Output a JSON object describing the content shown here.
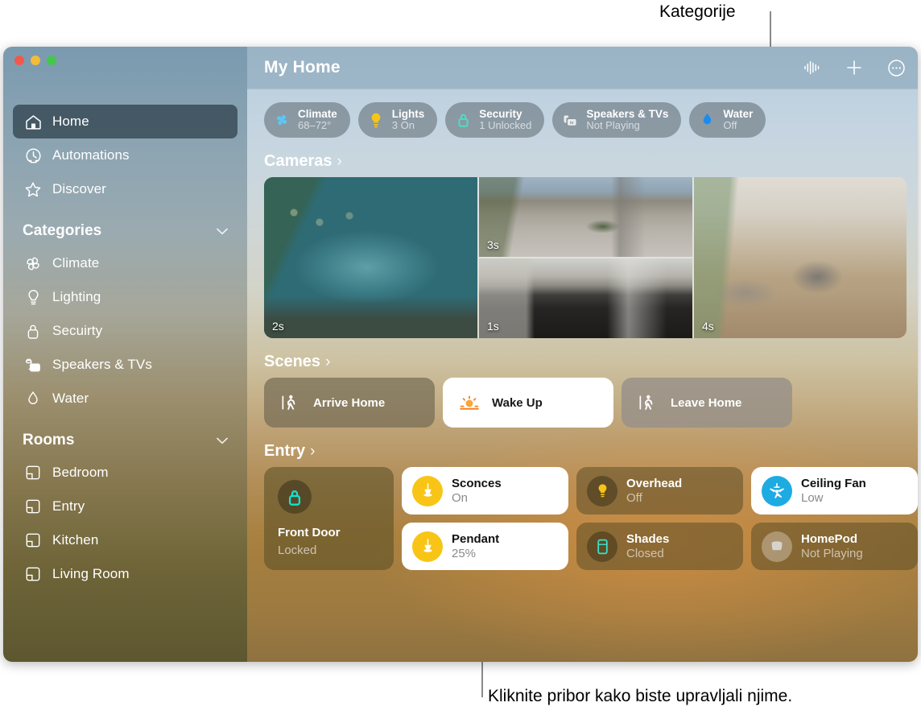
{
  "callouts": {
    "top": "Kategorije",
    "bottom": "Kliknite pribor kako biste upravljali njime."
  },
  "window": {
    "traffic_lights": [
      "close",
      "minimize",
      "zoom"
    ]
  },
  "sidebar": {
    "primary": [
      {
        "label": "Home",
        "icon": "house-icon",
        "selected": true
      },
      {
        "label": "Automations",
        "icon": "clock-icon",
        "selected": false
      },
      {
        "label": "Discover",
        "icon": "star-icon",
        "selected": false
      }
    ],
    "categories_header": "Categories",
    "categories": [
      {
        "label": "Climate",
        "icon": "fan-icon"
      },
      {
        "label": "Lighting",
        "icon": "bulb-icon"
      },
      {
        "label": "Secuirty",
        "icon": "lock-icon"
      },
      {
        "label": "Speakers & TVs",
        "icon": "speaker-tv-icon"
      },
      {
        "label": "Water",
        "icon": "droplet-icon"
      }
    ],
    "rooms_header": "Rooms",
    "rooms": [
      {
        "label": "Bedroom",
        "icon": "room-icon"
      },
      {
        "label": "Entry",
        "icon": "room-icon"
      },
      {
        "label": "Kitchen",
        "icon": "room-icon"
      },
      {
        "label": "Living Room",
        "icon": "room-icon"
      }
    ]
  },
  "toolbar": {
    "title": "My Home",
    "buttons": [
      {
        "name": "siri-waveform-icon"
      },
      {
        "name": "plus-icon"
      },
      {
        "name": "more-ellipsis-icon"
      }
    ]
  },
  "status_pills": [
    {
      "name": "Climate",
      "value": "68–72°",
      "icon": "fan-icon",
      "color": "#5ac8f5"
    },
    {
      "name": "Lights",
      "value": "3 On",
      "icon": "bulb-icon",
      "color": "#f8c517"
    },
    {
      "name": "Security",
      "value": "1 Unlocked",
      "icon": "lock-icon",
      "color": "#4ae0c8"
    },
    {
      "name": "Speakers & TVs",
      "value": "Not Playing",
      "icon": "speaker-tv-icon",
      "color": "#e8e8e8"
    },
    {
      "name": "Water",
      "value": "Off",
      "icon": "droplet-icon",
      "color": "#1a8cf0"
    }
  ],
  "sections": {
    "cameras": {
      "title": "Cameras",
      "arrow": "›"
    },
    "scenes": {
      "title": "Scenes",
      "arrow": "›"
    },
    "entry": {
      "title": "Entry",
      "arrow": "›"
    }
  },
  "cameras": [
    {
      "name": "backyard-pool-camera",
      "timestamp": "2s"
    },
    {
      "name": "driveway-camera",
      "timestamp": "3s"
    },
    {
      "name": "garage-camera",
      "timestamp": "1s"
    },
    {
      "name": "living-room-camera",
      "timestamp": "4s"
    }
  ],
  "scenes": [
    {
      "label": "Arrive Home",
      "icon": "walking-figure-icon",
      "active": false,
      "style": "warm"
    },
    {
      "label": "Wake Up",
      "icon": "sunrise-icon",
      "active": true,
      "style": "on"
    },
    {
      "label": "Leave Home",
      "icon": "walking-figure-icon",
      "active": false,
      "style": "grey"
    }
  ],
  "entry_accessories": {
    "lock": {
      "name": "Front Door",
      "status": "Locked",
      "icon": "lock-icon",
      "color": "#16e0d0"
    },
    "tiles": [
      {
        "name": "Sconces",
        "status": "On",
        "icon": "sconce-icon",
        "on": true,
        "icon_style": "ico-yellow"
      },
      {
        "name": "Overhead",
        "status": "Off",
        "icon": "bulb-icon",
        "on": false,
        "icon_style": "ico-dim"
      },
      {
        "name": "Ceiling Fan",
        "status": "Low",
        "icon": "ceiling-fan-icon",
        "on": true,
        "icon_style": "ico-blue"
      },
      {
        "name": "Pendant",
        "status": "25%",
        "icon": "sconce-icon",
        "on": true,
        "icon_style": "ico-yellow"
      },
      {
        "name": "Shades",
        "status": "Closed",
        "icon": "shade-icon",
        "on": false,
        "icon_style": "ico-dim"
      },
      {
        "name": "HomePod",
        "status": "Not Playing",
        "icon": "homepod-icon",
        "on": false,
        "icon_style": "ico-grey"
      }
    ]
  }
}
